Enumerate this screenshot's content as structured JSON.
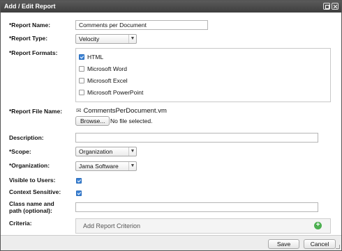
{
  "dialog": {
    "title": "Add / Edit Report"
  },
  "fields": {
    "report_name_label": "*Report Name:",
    "report_name_value": "Comments per Document",
    "report_type_label": "*Report Type:",
    "report_type_value": "Velocity",
    "report_formats_label": "*Report Formats:",
    "formats": [
      {
        "label": "HTML",
        "checked": true
      },
      {
        "label": "Microsoft Word",
        "checked": false
      },
      {
        "label": "Microsoft Excel",
        "checked": false
      },
      {
        "label": "Microsoft PowerPoint",
        "checked": false
      }
    ],
    "report_file_name_label": "*Report File Name:",
    "report_file_name_value": "CommentsPerDocument.vm",
    "browse_label": "Browse...",
    "no_file_text": "No file selected.",
    "description_label": "Description:",
    "description_value": "",
    "scope_label": "*Scope:",
    "scope_value": "Organization",
    "organization_label": "*Organization:",
    "organization_value": "Jama Software",
    "visible_label": "Visible to Users:",
    "visible_checked": true,
    "context_label": "Context Sensitive:",
    "context_checked": true,
    "class_label_line1": "Class name and",
    "class_label_line2": "path (optional):",
    "class_value": "",
    "criteria_label": "Criteria:",
    "criteria_add_text": "Add Report Criterion"
  },
  "footer": {
    "save_label": "Save",
    "cancel_label": "Cancel"
  },
  "icons": {
    "minimize": "maximize-icon",
    "close": "close-icon",
    "attachment": "paperclip-icon",
    "add": "plus-circle-icon"
  },
  "colors": {
    "titlebar": "#4a4a4a",
    "checkbox_checked": "#3b82d6",
    "add_icon": "#4caf50"
  }
}
